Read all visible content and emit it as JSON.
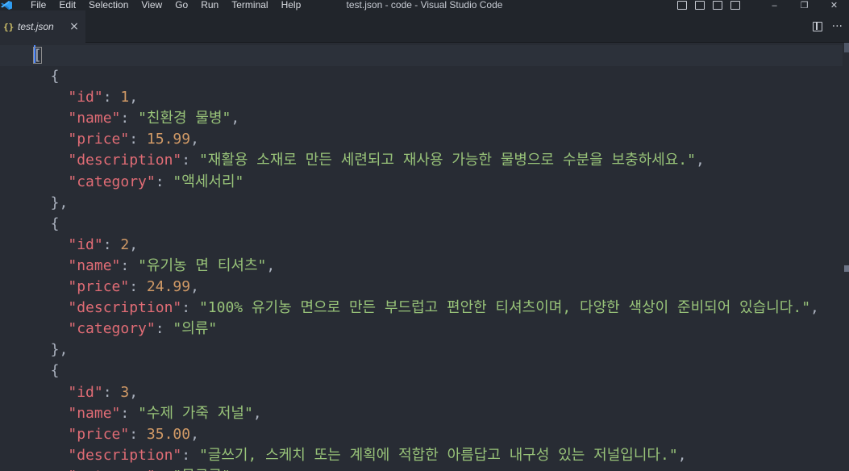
{
  "menu": [
    "File",
    "Edit",
    "Selection",
    "View",
    "Go",
    "Run",
    "Terminal",
    "Help"
  ],
  "window_title": "test.json - code - Visual Studio Code",
  "tab": {
    "icon": "{}",
    "label": "test.json",
    "close": "×"
  },
  "editor": {
    "lines": [
      [
        {
          "t": "p",
          "v": "["
        }
      ],
      [
        {
          "t": "p",
          "v": "  {"
        }
      ],
      [
        {
          "t": "p",
          "v": "    "
        },
        {
          "t": "k",
          "v": "\"id\""
        },
        {
          "t": "p",
          "v": ": "
        },
        {
          "t": "n",
          "v": "1"
        },
        {
          "t": "p",
          "v": ","
        }
      ],
      [
        {
          "t": "p",
          "v": "    "
        },
        {
          "t": "k",
          "v": "\"name\""
        },
        {
          "t": "p",
          "v": ": "
        },
        {
          "t": "s",
          "v": "\"친환경 물병\""
        },
        {
          "t": "p",
          "v": ","
        }
      ],
      [
        {
          "t": "p",
          "v": "    "
        },
        {
          "t": "k",
          "v": "\"price\""
        },
        {
          "t": "p",
          "v": ": "
        },
        {
          "t": "n",
          "v": "15.99"
        },
        {
          "t": "p",
          "v": ","
        }
      ],
      [
        {
          "t": "p",
          "v": "    "
        },
        {
          "t": "k",
          "v": "\"description\""
        },
        {
          "t": "p",
          "v": ": "
        },
        {
          "t": "s",
          "v": "\"재활용 소재로 만든 세련되고 재사용 가능한 물병으로 수분을 보충하세요.\""
        },
        {
          "t": "p",
          "v": ","
        }
      ],
      [
        {
          "t": "p",
          "v": "    "
        },
        {
          "t": "k",
          "v": "\"category\""
        },
        {
          "t": "p",
          "v": ": "
        },
        {
          "t": "s",
          "v": "\"액세서리\""
        }
      ],
      [
        {
          "t": "p",
          "v": "  },"
        }
      ],
      [
        {
          "t": "p",
          "v": "  {"
        }
      ],
      [
        {
          "t": "p",
          "v": "    "
        },
        {
          "t": "k",
          "v": "\"id\""
        },
        {
          "t": "p",
          "v": ": "
        },
        {
          "t": "n",
          "v": "2"
        },
        {
          "t": "p",
          "v": ","
        }
      ],
      [
        {
          "t": "p",
          "v": "    "
        },
        {
          "t": "k",
          "v": "\"name\""
        },
        {
          "t": "p",
          "v": ": "
        },
        {
          "t": "s",
          "v": "\"유기농 면 티셔츠\""
        },
        {
          "t": "p",
          "v": ","
        }
      ],
      [
        {
          "t": "p",
          "v": "    "
        },
        {
          "t": "k",
          "v": "\"price\""
        },
        {
          "t": "p",
          "v": ": "
        },
        {
          "t": "n",
          "v": "24.99"
        },
        {
          "t": "p",
          "v": ","
        }
      ],
      [
        {
          "t": "p",
          "v": "    "
        },
        {
          "t": "k",
          "v": "\"description\""
        },
        {
          "t": "p",
          "v": ": "
        },
        {
          "t": "s",
          "v": "\"100% 유기농 면으로 만든 부드럽고 편안한 티셔츠이며, 다양한 색상이 준비되어 있습니다.\""
        },
        {
          "t": "p",
          "v": ","
        }
      ],
      [
        {
          "t": "p",
          "v": "    "
        },
        {
          "t": "k",
          "v": "\"category\""
        },
        {
          "t": "p",
          "v": ": "
        },
        {
          "t": "s",
          "v": "\"의류\""
        }
      ],
      [
        {
          "t": "p",
          "v": "  },"
        }
      ],
      [
        {
          "t": "p",
          "v": "  {"
        }
      ],
      [
        {
          "t": "p",
          "v": "    "
        },
        {
          "t": "k",
          "v": "\"id\""
        },
        {
          "t": "p",
          "v": ": "
        },
        {
          "t": "n",
          "v": "3"
        },
        {
          "t": "p",
          "v": ","
        }
      ],
      [
        {
          "t": "p",
          "v": "    "
        },
        {
          "t": "k",
          "v": "\"name\""
        },
        {
          "t": "p",
          "v": ": "
        },
        {
          "t": "s",
          "v": "\"수제 가죽 저널\""
        },
        {
          "t": "p",
          "v": ","
        }
      ],
      [
        {
          "t": "p",
          "v": "    "
        },
        {
          "t": "k",
          "v": "\"price\""
        },
        {
          "t": "p",
          "v": ": "
        },
        {
          "t": "n",
          "v": "35.00"
        },
        {
          "t": "p",
          "v": ","
        }
      ],
      [
        {
          "t": "p",
          "v": "    "
        },
        {
          "t": "k",
          "v": "\"description\""
        },
        {
          "t": "p",
          "v": ": "
        },
        {
          "t": "s",
          "v": "\"글쓰기, 스케치 또는 계획에 적합한 아름답고 내구성 있는 저널입니다.\""
        },
        {
          "t": "p",
          "v": ","
        }
      ],
      [
        {
          "t": "p",
          "v": "    "
        },
        {
          "t": "k",
          "v": "\"category\""
        },
        {
          "t": "p",
          "v": ": "
        },
        {
          "t": "s",
          "v": "\"문구류\""
        }
      ]
    ]
  },
  "colors": {
    "background": "#282c34",
    "key": "#e06c75",
    "string": "#98c379",
    "number": "#d19a66",
    "punctuation": "#abb2bf",
    "cursor": "#528bff"
  },
  "icons": {
    "app": "vscode-logo-icon",
    "layout": [
      "customize-layout-icon",
      "toggle-sidebar-icon",
      "toggle-panel-icon",
      "toggle-secondary-sidebar-icon"
    ],
    "window": [
      "minimize-icon",
      "restore-icon",
      "close-icon"
    ],
    "editor_actions": [
      "split-editor-icon",
      "more-actions-icon"
    ]
  }
}
